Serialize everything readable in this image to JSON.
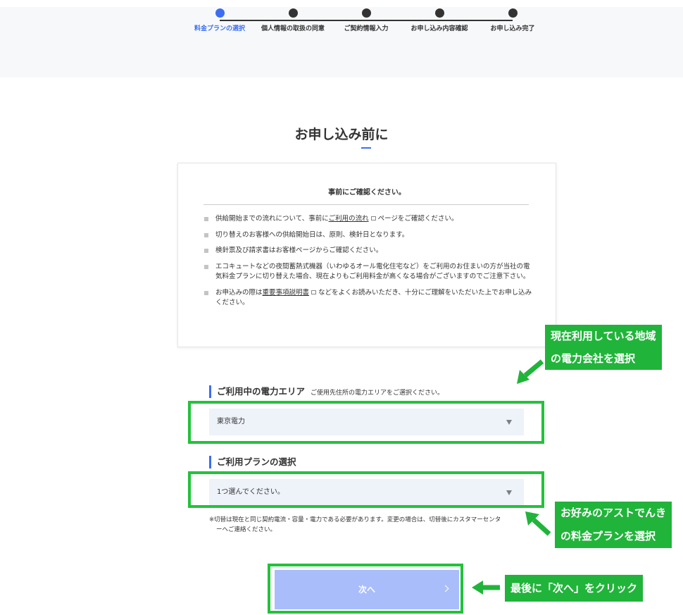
{
  "steps": [
    {
      "label": "料金プランの選択",
      "active": true
    },
    {
      "label": "個人情報の取扱の同意",
      "active": false
    },
    {
      "label": "ご契約情報入力",
      "active": false
    },
    {
      "label": "お申し込み内容確認",
      "active": false
    },
    {
      "label": "お申し込み完了",
      "active": false
    }
  ],
  "page_title": "お申し込み前に",
  "notice": {
    "heading": "事前にご確認ください。",
    "item1_before": "供給開始までの流れについて、事前に",
    "item1_link": "ご利用の流れ",
    "item1_after": "ページをご確認ください。",
    "item2": "切り替えのお客様への供給開始日は、原則、検針日となります。",
    "item3": "検針票及び請求書はお客様ページからご確認ください。",
    "item4": "エコキュートなどの夜間蓄熱式機器（いわゆるオール電化住宅など）をご利用のお住まいの方が当社の電気料金プランに切り替えた場合、現在よりもご利用料金が高くなる場合がございますのでご注意下さい。",
    "item5_before": "お申込みの際は",
    "item5_link": "重要事項説明書",
    "item5_after": "などをよくお読みいただき、十分にご理解をいただいた上でお申し込みください。"
  },
  "area": {
    "heading": "ご利用中の電力エリア",
    "sub": "ご使用先住所の電力エリアをご選択ください。",
    "value": "東京電力"
  },
  "plan": {
    "heading": "ご利用プランの選択",
    "value": "1つ選んでください。"
  },
  "note_line1": "※切替は現在と同じ契約電流・容量・電力である必要があります。変更の場合は、切替後にカスタマーセンタ",
  "note_line2": "ーへご連絡ください。",
  "next_label": "次へ",
  "callouts": {
    "area_line1": "現在利用している地域",
    "area_line2": "の電力会社を選択",
    "plan_line1": "お好みのアストでんき",
    "plan_line2": "の料金プランを選択",
    "next": "最後に「次へ」をクリック"
  },
  "colors": {
    "accent": "#3b6ef0",
    "highlight": "#22c33a",
    "callout": "#21b43a",
    "button": "#a9bdfa"
  }
}
